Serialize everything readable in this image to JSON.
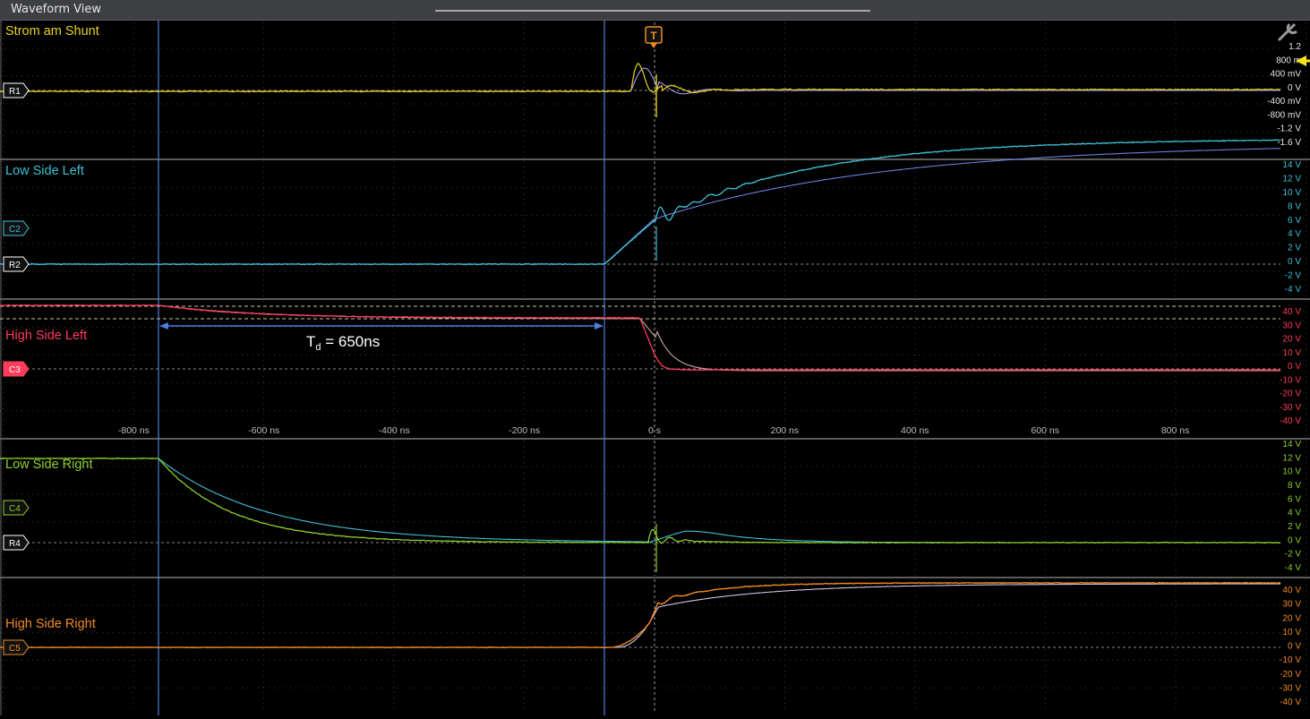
{
  "window": {
    "title": "Waveform View"
  },
  "trigger": {
    "marker": "T",
    "top_marker": "T"
  },
  "measurement": {
    "label_main": "T",
    "label_sub": "d",
    "label_value": " = 650ns"
  },
  "time_axis": {
    "labels": [
      "-800 ns",
      "-600 ns",
      "-400 ns",
      "-200 ns",
      "0 s",
      "200 ns",
      "400 ns",
      "600 ns",
      "800 ns"
    ]
  },
  "panels": [
    {
      "name": "Strom am Shunt",
      "color": "#e8d21f",
      "markers": [
        {
          "label": "R1",
          "color": "#ffffff"
        }
      ],
      "scale": [
        "1.2",
        "800 m",
        "400 mV",
        "0 V",
        "-400 mV",
        "-800 mV",
        "-1.2 V",
        "-1.6 V"
      ],
      "scale_color": "#e6e6e6"
    },
    {
      "name": "Low Side Left",
      "color": "#3ec1d6",
      "markers": [
        {
          "label": "C2",
          "color": "#3ec1d6"
        },
        {
          "label": "R2",
          "color": "#ffffff"
        }
      ],
      "scale": [
        "14 V",
        "12 V",
        "10 V",
        "8 V",
        "6 V",
        "4 V",
        "2 V",
        "0 V",
        "-2 V",
        "-4 V"
      ],
      "scale_color": "#3ec1d6"
    },
    {
      "name": "High Side Left",
      "color": "#ff3b5c",
      "markers": [
        {
          "label": "C3",
          "color": "#ff3b5c"
        }
      ],
      "scale": [
        "40 V",
        "30 V",
        "20 V",
        "10 V",
        "0 V",
        "-10 V",
        "-20 V",
        "-30 V",
        "-40 V"
      ],
      "scale_color": "#ff3b5c"
    },
    {
      "name": "Low Side Right",
      "color": "#8fce2a",
      "markers": [
        {
          "label": "C4",
          "color": "#8fce2a"
        },
        {
          "label": "R4",
          "color": "#ffffff"
        }
      ],
      "scale": [
        "14 V",
        "12 V",
        "10 V",
        "8 V",
        "6 V",
        "4 V",
        "2 V",
        "0 V",
        "-2 V",
        "-4 V"
      ],
      "scale_color": "#8fce2a"
    },
    {
      "name": "High Side Right",
      "color": "#f08a24",
      "markers": [
        {
          "label": "C5",
          "color": "#f08a24"
        }
      ],
      "scale": [
        "40 V",
        "30 V",
        "20 V",
        "10 V",
        "0 V",
        "-10 V",
        "-20 V",
        "-30 V",
        "-40 V"
      ],
      "scale_color": "#f08a24"
    }
  ]
}
